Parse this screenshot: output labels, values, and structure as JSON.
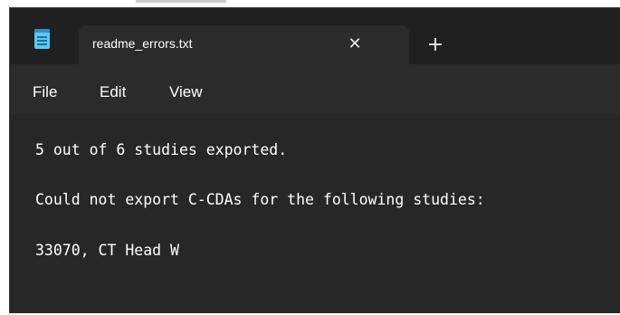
{
  "window": {
    "tab_title": "readme_errors.txt",
    "close_glyph": "✕",
    "new_tab_glyph": "+",
    "app_icon": "notepad-icon"
  },
  "menu": {
    "file": "File",
    "edit": "Edit",
    "view": "View"
  },
  "document": {
    "lines": [
      "5 out of 6 studies exported.",
      "Could not export C-CDAs for the following studies:",
      "33070, CT Head W"
    ]
  },
  "colors": {
    "titlebar_bg": "#202020",
    "tab_bg": "#2b2b2b",
    "editor_bg": "#272727",
    "text": "#ffffff",
    "icon_accent": "#5cc9f0"
  }
}
